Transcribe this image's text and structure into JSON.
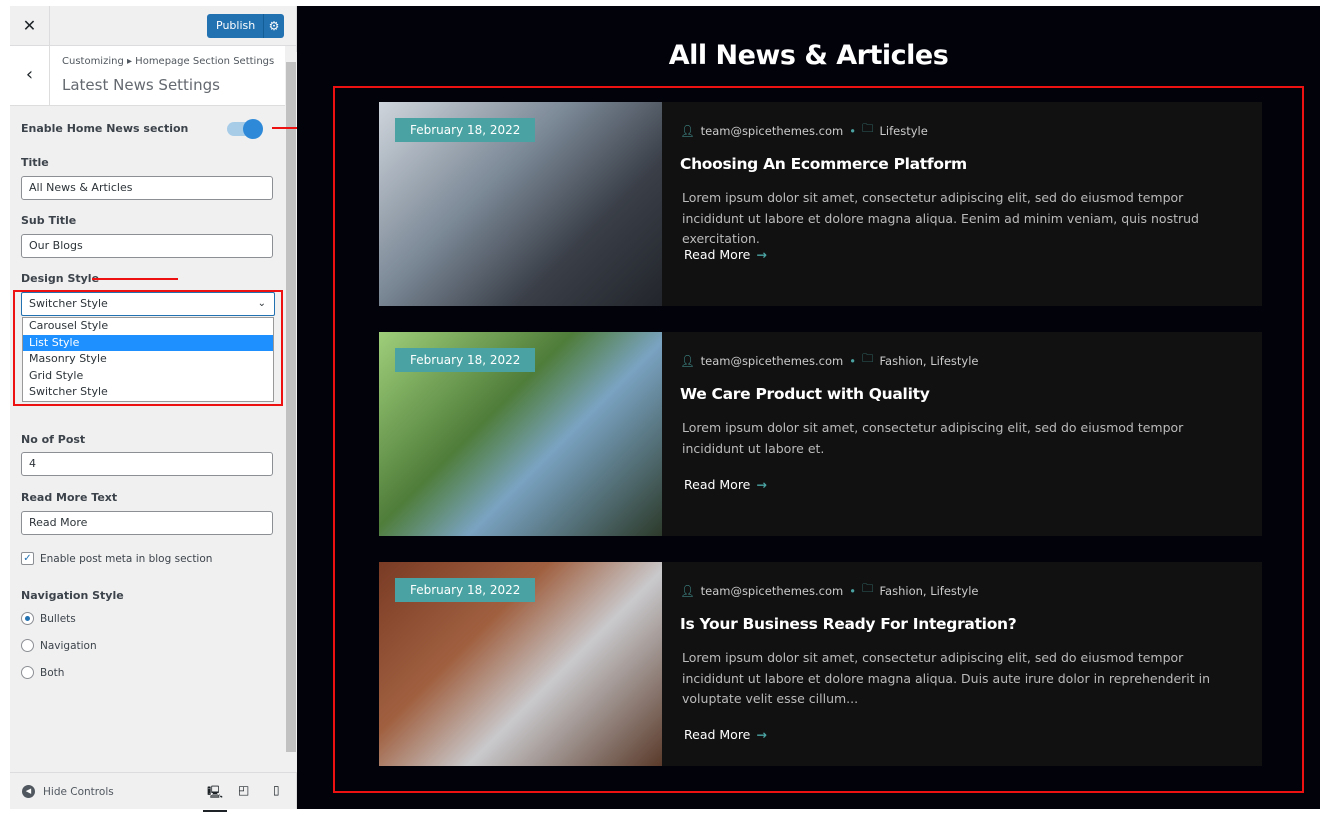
{
  "sidebar": {
    "publish_label": "Publish",
    "breadcrumb": "Customizing ▸ Homepage Section Settings",
    "panel_title": "Latest News Settings",
    "enable_label": "Enable Home News section",
    "enable_on": true,
    "title_label": "Title",
    "title_value": "All News & Articles",
    "subtitle_label": "Sub Title",
    "subtitle_value": "Our Blogs",
    "design_label": "Design Style",
    "design_value": "Switcher Style",
    "design_options": [
      "Carousel Style",
      "List Style",
      "Masonry Style",
      "Grid Style",
      "Switcher Style"
    ],
    "highlighted_option": "List Style",
    "posts_label": "No of Post",
    "posts_value": "4",
    "readmore_label": "Read More Text",
    "readmore_value": "Read More",
    "meta_checkbox_label": "Enable post meta in blog section",
    "meta_checked": true,
    "nav_label": "Navigation Style",
    "nav_options": [
      "Bullets",
      "Navigation",
      "Both"
    ],
    "nav_selected": "Bullets",
    "hide_controls": "Hide Controls"
  },
  "preview": {
    "title": "All News & Articles",
    "accent": "#4aa3a2",
    "posts": [
      {
        "date": "February 18, 2022",
        "author": "team@spicethemes.com",
        "category": "Lifestyle",
        "title": "Choosing An Ecommerce Platform",
        "excerpt": "Lorem ipsum dolor sit amet, consectetur adipiscing elit, sed do eiusmod tempor incididunt ut labore et dolore magna aliqua. Eenim ad minim veniam, quis nostrud exercitation.",
        "read_more": "Read More"
      },
      {
        "date": "February 18, 2022",
        "author": "team@spicethemes.com",
        "category": "Fashion, Lifestyle",
        "title": "We Care Product with Quality",
        "excerpt": "Lorem ipsum dolor sit amet, consectetur adipiscing elit, sed do eiusmod tempor incididunt ut labore et.",
        "read_more": "Read More"
      },
      {
        "date": "February 18, 2022",
        "author": "team@spicethemes.com",
        "category": "Fashion, Lifestyle",
        "title": "Is Your Business Ready For Integration?",
        "excerpt": "Lorem ipsum dolor sit amet, consectetur adipiscing elit, sed do eiusmod tempor incididunt ut labore et dolore magna aliqua. Duis aute irure dolor in reprehenderit in voluptate velit esse cillum...",
        "read_more": "Read More"
      }
    ]
  }
}
